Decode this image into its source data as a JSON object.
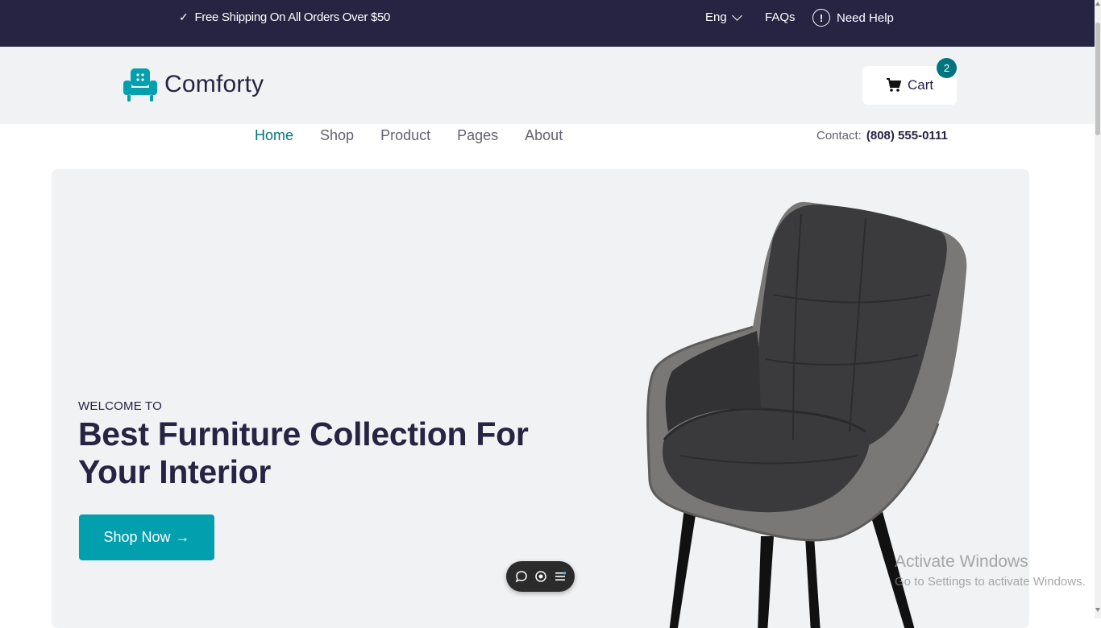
{
  "topbar": {
    "shipping_text": "Free Shipping On All Orders Over $50",
    "check_icon": "check-icon",
    "language": "Eng",
    "faqs": "FAQs",
    "need_help": "Need Help",
    "help_symbol": "!",
    "check_symbol": "✓"
  },
  "header": {
    "logo_text": "Comforty",
    "logo_icon": "armchair-icon",
    "cart_label": "Cart",
    "cart_count": "2",
    "cart_icon": "cart-icon"
  },
  "nav": {
    "items": [
      {
        "label": "Home",
        "active": true
      },
      {
        "label": "Shop",
        "active": false
      },
      {
        "label": "Product",
        "active": false
      },
      {
        "label": "Pages",
        "active": false
      },
      {
        "label": "About",
        "active": false
      }
    ],
    "contact_label": "Contact:",
    "contact_phone": "(808) 555-0111"
  },
  "hero": {
    "eyebrow": "WELCOME TO",
    "title": "Best Furniture Collection For Your Interior",
    "cta_label": "Shop Now",
    "cta_arrow": "→",
    "image": "armchair-image"
  },
  "floating_toolbar": {
    "icons": [
      "chat-icon",
      "toggle-icon",
      "list-icon"
    ]
  },
  "watermark": {
    "line1": "Activate Windows",
    "line2": "Go to Settings to activate Windows."
  },
  "colors": {
    "topbar_bg": "#272343",
    "accent": "#029fae",
    "teal": "#007580",
    "hero_bg": "#f0f2f3",
    "text_dark": "#272343"
  }
}
